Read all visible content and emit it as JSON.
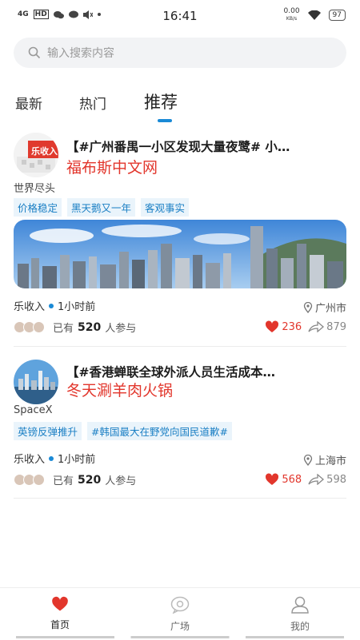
{
  "status_bar": {
    "left_icons": [
      "4G",
      "HD"
    ],
    "time": "16:41",
    "net_speed_value": "0.00",
    "net_speed_unit": "KB/s",
    "battery": "97"
  },
  "search": {
    "placeholder": "输入搜索内容"
  },
  "tabs": [
    {
      "label": "最新",
      "active": false
    },
    {
      "label": "热门",
      "active": false
    },
    {
      "label": "推荐",
      "active": true
    }
  ],
  "posts": [
    {
      "title": "【#广州番禺一小区发现大量夜鹭# 小…",
      "subtitle": "福布斯中文网",
      "author": "世界尽头",
      "tags": [
        "价格稳定",
        "黑天鹅又一年",
        "客观事实"
      ],
      "has_banner": true,
      "source": "乐收入",
      "time": "1小时前",
      "location": "广州市",
      "participants_prefix": "已有",
      "participants_count": "520",
      "participants_suffix": "人参与",
      "likes": "236",
      "shares": "879",
      "avatar_text": "乐收入"
    },
    {
      "title": "【#香港蝉联全球外派人员生活成本…",
      "subtitle": "冬天涮羊肉火锅",
      "author": "SpaceX",
      "tags": [
        "英镑反弹推升",
        "#韩国最大在野党向国民道歉#"
      ],
      "has_banner": false,
      "source": "乐收入",
      "time": "1小时前",
      "location": "上海市",
      "participants_prefix": "已有",
      "participants_count": "520",
      "participants_suffix": "人参与",
      "likes": "568",
      "shares": "598"
    }
  ],
  "bottom_nav": [
    {
      "label": "首页",
      "icon": "heart-icon",
      "active": true
    },
    {
      "label": "广场",
      "icon": "chat-bubble-icon",
      "active": false
    },
    {
      "label": "我的",
      "icon": "user-icon",
      "active": false
    }
  ],
  "colors": {
    "accent": "#1a8ad6",
    "red": "#e2362c",
    "tag_bg": "#eaf4fb"
  }
}
